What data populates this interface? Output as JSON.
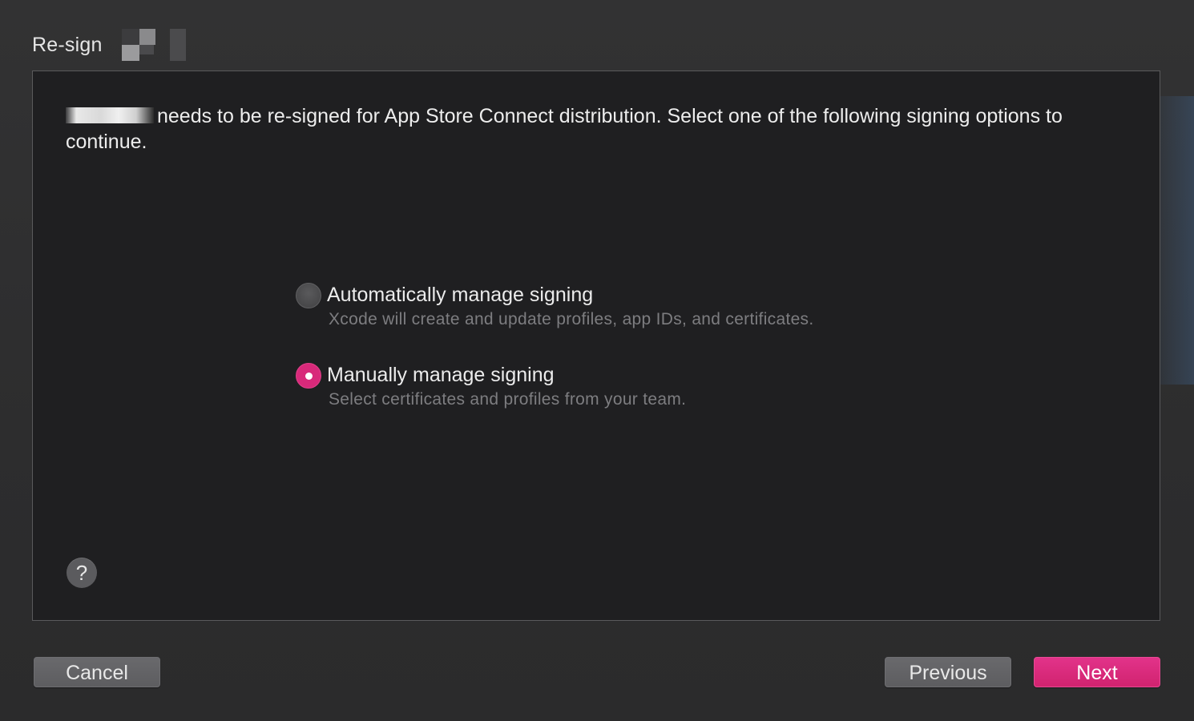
{
  "window": {
    "title": "Re-sign"
  },
  "message": {
    "text": "needs to be re-signed for App Store Connect distribution. Select one of the following signing options to continue."
  },
  "signing_options": [
    {
      "title": "Automatically manage signing",
      "description": "Xcode will create and update profiles, app IDs, and certificates.",
      "selected": false
    },
    {
      "title": "Manually manage signing",
      "description": "Select certificates and profiles from your team.",
      "selected": true
    }
  ],
  "help": {
    "label": "?",
    "icon": "help-icon"
  },
  "buttons": {
    "cancel": "Cancel",
    "previous": "Previous",
    "next": "Next"
  },
  "colors": {
    "accent": "#d8297a",
    "content_bg": "#1f1f21",
    "window_bg": "#2d2d2e"
  }
}
